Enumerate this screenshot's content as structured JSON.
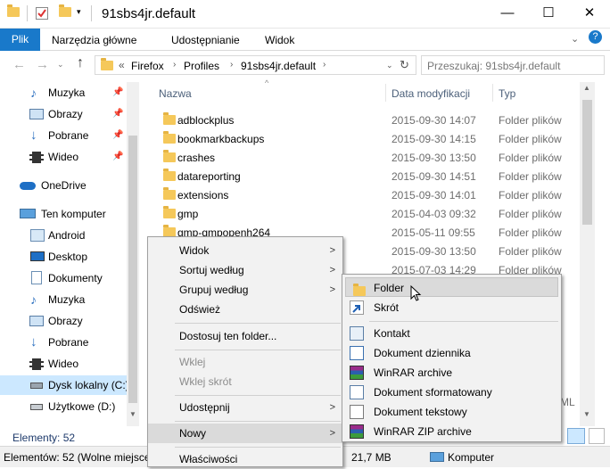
{
  "window": {
    "title": "91sbs4jr.default",
    "controls": {
      "minimize": "—",
      "maximize": "☐",
      "close": "✕"
    }
  },
  "ribbon": {
    "file_tab": "Plik",
    "tabs": [
      "Narzędzia główne",
      "Udostępnianie",
      "Widok"
    ]
  },
  "address": {
    "prefix": "«",
    "crumbs": [
      "Firefox",
      "Profiles",
      "91sbs4jr.default"
    ],
    "search_placeholder": "Przeszukaj: 91sbs4jr.default"
  },
  "nav": {
    "items": [
      {
        "label": "Muzyka",
        "icon": "music-icon",
        "pinned": true
      },
      {
        "label": "Obrazy",
        "icon": "pictures-icon",
        "pinned": true
      },
      {
        "label": "Pobrane",
        "icon": "download-icon",
        "pinned": true
      },
      {
        "label": "Wideo",
        "icon": "video-icon",
        "pinned": true
      },
      {
        "label": "OneDrive",
        "icon": "cloud-icon"
      },
      {
        "label": "Ten komputer",
        "icon": "computer-icon"
      },
      {
        "label": "Android",
        "icon": "android-icon"
      },
      {
        "label": "Desktop",
        "icon": "desktop-icon"
      },
      {
        "label": "Dokumenty",
        "icon": "documents-icon"
      },
      {
        "label": "Muzyka",
        "icon": "music-icon"
      },
      {
        "label": "Obrazy",
        "icon": "pictures-icon"
      },
      {
        "label": "Pobrane",
        "icon": "download-icon"
      },
      {
        "label": "Wideo",
        "icon": "video-icon"
      },
      {
        "label": "Dysk lokalny (C:)",
        "icon": "drive-icon",
        "selected": true
      },
      {
        "label": "Użytkowe (D:)",
        "icon": "drive-icon"
      }
    ]
  },
  "list": {
    "headers": {
      "name": "Nazwa",
      "date": "Data modyfikacji",
      "type": "Typ"
    },
    "rows": [
      {
        "name": "adblockplus",
        "date": "2015-09-30 14:07",
        "type": "Folder plików"
      },
      {
        "name": "bookmarkbackups",
        "date": "2015-09-30 14:15",
        "type": "Folder plików"
      },
      {
        "name": "crashes",
        "date": "2015-09-30 13:50",
        "type": "Folder plików"
      },
      {
        "name": "datareporting",
        "date": "2015-09-30 14:51",
        "type": "Folder plików"
      },
      {
        "name": "extensions",
        "date": "2015-09-30 14:01",
        "type": "Folder plików"
      },
      {
        "name": "gmp",
        "date": "2015-04-03 09:32",
        "type": "Folder plików"
      },
      {
        "name": "gmp-gmpopenh264",
        "date": "2015-05-11 09:55",
        "type": "Folder plików"
      },
      {
        "name": "",
        "date": "2015-09-30 13:50",
        "type": "Folder plików"
      },
      {
        "name": "",
        "date": "2015-07-03 14:29",
        "type": "Folder plików"
      }
    ],
    "partial_type_bottom": "ML"
  },
  "status": {
    "elements": "Elementy: 52",
    "bottom_left": "Elementów: 52 (Wolne miejsce",
    "size": "21,7 MB",
    "location": "Komputer"
  },
  "context_menu": {
    "items": [
      {
        "label": "Widok",
        "submenu": true
      },
      {
        "label": "Sortuj według",
        "submenu": true
      },
      {
        "label": "Grupuj według",
        "submenu": true
      },
      {
        "label": "Odśwież"
      },
      {
        "label": "Dostosuj ten folder..."
      },
      {
        "label": "Wklej",
        "disabled": true
      },
      {
        "label": "Wklej skrót",
        "disabled": true
      },
      {
        "label": "Udostępnij",
        "submenu": true
      },
      {
        "label": "Nowy",
        "submenu": true,
        "hover": true
      },
      {
        "label": "Właściwości"
      }
    ]
  },
  "new_submenu": {
    "items": [
      {
        "label": "Folder",
        "icon": "folder-icon",
        "hover": true
      },
      {
        "label": "Skrót",
        "icon": "shortcut-icon"
      },
      {
        "label": "Kontakt",
        "icon": "contact-icon"
      },
      {
        "label": "Dokument dziennika",
        "icon": "journal-icon"
      },
      {
        "label": "WinRAR archive",
        "icon": "winrar-icon"
      },
      {
        "label": "Dokument sformatowany",
        "icon": "rtf-document-icon"
      },
      {
        "label": "Dokument tekstowy",
        "icon": "text-document-icon"
      },
      {
        "label": "WinRAR ZIP archive",
        "icon": "winrar-zip-icon"
      }
    ]
  },
  "colors": {
    "accent": "#1979ca",
    "selection": "#cce8ff",
    "folder": "#f5c85a",
    "menu_bg": "#f2f2f2"
  }
}
